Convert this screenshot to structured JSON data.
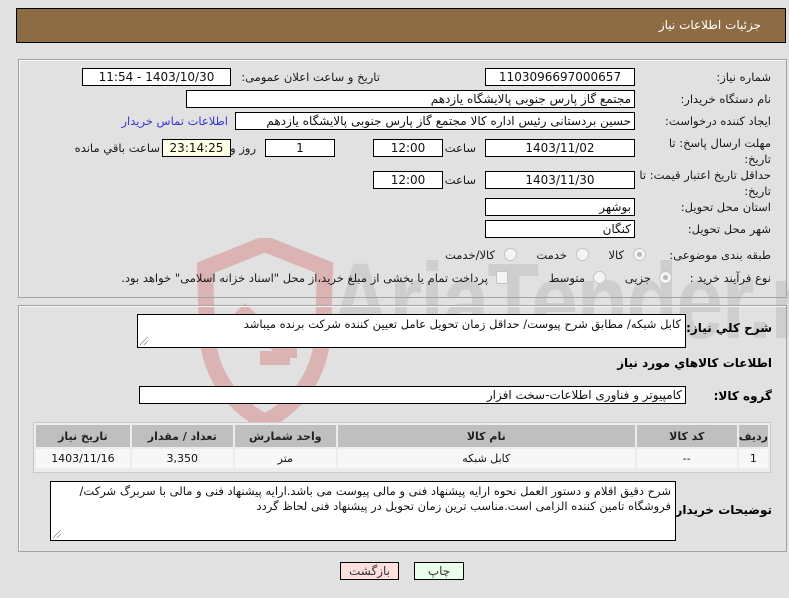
{
  "header": {
    "title": "جزئیات اطلاعات نیاز"
  },
  "details": {
    "need_number": {
      "label": "شماره نیاز:",
      "value": "1103096697000657"
    },
    "announce_datetime": {
      "label": "تاریخ و ساعت اعلان عمومی:",
      "value": "1403/10/30 - 11:54"
    },
    "buyer_org": {
      "label": "نام دستگاه خریدار:",
      "value": "مجتمع گاز پارس جنوبی  پالایشگاه یازدهم"
    },
    "requester": {
      "label": "ایجاد کننده درخواست:",
      "value": "حسین بردستانی رئیس اداره کالا مجتمع گاز پارس جنوبی  پالایشگاه یازدهم",
      "contact_link": "اطلاعات تماس خریدار"
    },
    "response_deadline": {
      "label_line1": "مهلت ارسال پاسخ: تا",
      "label_line2": "تاریخ:",
      "date": "1403/11/02",
      "time_label": "ساعت",
      "time": "12:00",
      "days": "1",
      "days_label": "روز و",
      "remaining": "23:14:25",
      "remaining_label": "ساعت باقي مانده"
    },
    "price_validity": {
      "label_line1": "حداقل تاریخ اعتبار قیمت: تا",
      "label_line2": "تاریخ:",
      "date": "1403/11/30",
      "time_label": "ساعت",
      "time": "12:00"
    },
    "province": {
      "label": "استان محل تحویل:",
      "value": "بوشهر"
    },
    "city": {
      "label": "شهر محل تحویل:",
      "value": "کنگان"
    },
    "category": {
      "label": "طبقه بندی موضوعی:",
      "selected": "کالا",
      "options": [
        "کالا",
        "خدمت",
        "کالا/خدمت"
      ]
    },
    "process_type": {
      "label": "نوع فرآیند خرید :",
      "selected": "جزیی",
      "options": [
        "جزیی",
        "متوسط"
      ],
      "treasury_checkbox": {
        "checked": false,
        "label": "پرداخت تمام یا بخشی از مبلغ خرید،از محل \"اسناد خزانه اسلامی\" خواهد بود."
      }
    }
  },
  "need_info": {
    "description_label": "شرح کلي نياز:",
    "description": "کابل شبکه/ مطابق شرح پیوست/ حداقل زمان تحویل عامل تعیین کننده شرکت برنده میباشد",
    "items_heading": "اطلاعات کالاهاي مورد نياز",
    "product_group_label": "گروه کالا:",
    "product_group": "کامپیوتر و فناوری اطلاعات-سخت افزار",
    "table": {
      "headers": [
        "ردیف",
        "کد کالا",
        "نام کالا",
        "واحد شمارش",
        "تعداد / مقدار",
        "تاریخ نیاز"
      ],
      "rows": [
        {
          "row": "1",
          "code": "--",
          "name": "کابل شبکه",
          "unit": "متر",
          "quantity": "3,350",
          "need_date": "1403/11/16"
        }
      ]
    },
    "buyer_notes_label": "توضیحات خریدار:",
    "buyer_notes": "شرح دقیق اقلام و دستور العمل نحوه ارایه پیشنهاد فنی و مالی پیوست می باشد.ارایه پیشنهاد فنی و مالی با سربرگ شرکت/فروشگاه تامین کننده الزامی است.مناسب ترین زمان تحویل در پیشنهاد فنی لحاظ گردد"
  },
  "buttons": {
    "back": "بازگشت",
    "print": "چاپ"
  },
  "colors": {
    "header_bg": "#8d6c43",
    "back_button_bg": "#ffdede",
    "print_button_bg": "#eaffea",
    "link": "#3535d0"
  },
  "watermark": {
    "text": "AriaTender.net"
  }
}
